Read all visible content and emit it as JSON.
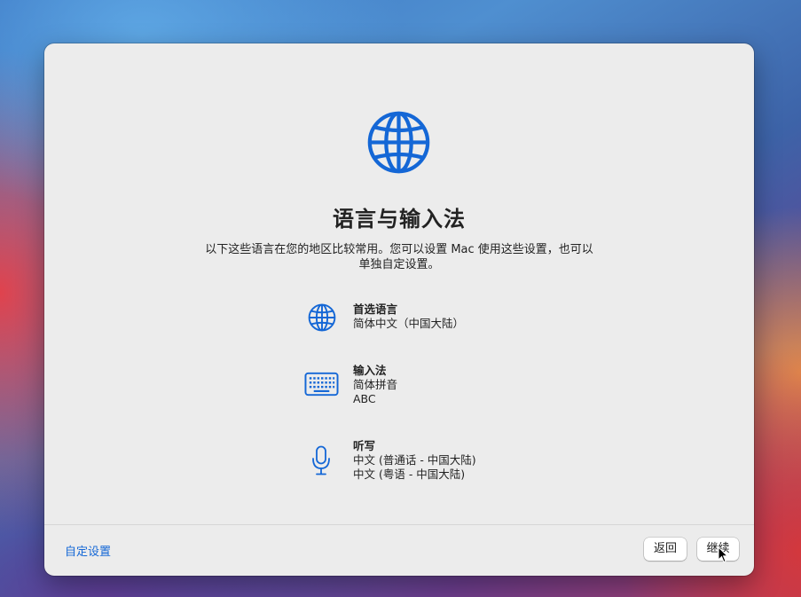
{
  "window": {
    "title": "语言与输入法",
    "description": "以下这些语言在您的地区比较常用。您可以设置 Mac 使用这些设置，也可以单独自定设置。",
    "hero_icon": "globe-icon"
  },
  "sections": [
    {
      "icon": "globe-icon",
      "heading": "首选语言",
      "lines": [
        "简体中文（中国大陆）"
      ]
    },
    {
      "icon": "keyboard-icon",
      "heading": "输入法",
      "lines": [
        "简体拼音",
        "ABC"
      ]
    },
    {
      "icon": "microphone-icon",
      "heading": "听写",
      "lines": [
        "中文 (普通话 - 中国大陆)",
        "中文 (粤语 - 中国大陆)"
      ]
    }
  ],
  "footer": {
    "customize_label": "自定设置",
    "back_label": "返回",
    "continue_label": "继续"
  },
  "colors": {
    "accent": "#1467d6",
    "window_background": "#ececec"
  }
}
